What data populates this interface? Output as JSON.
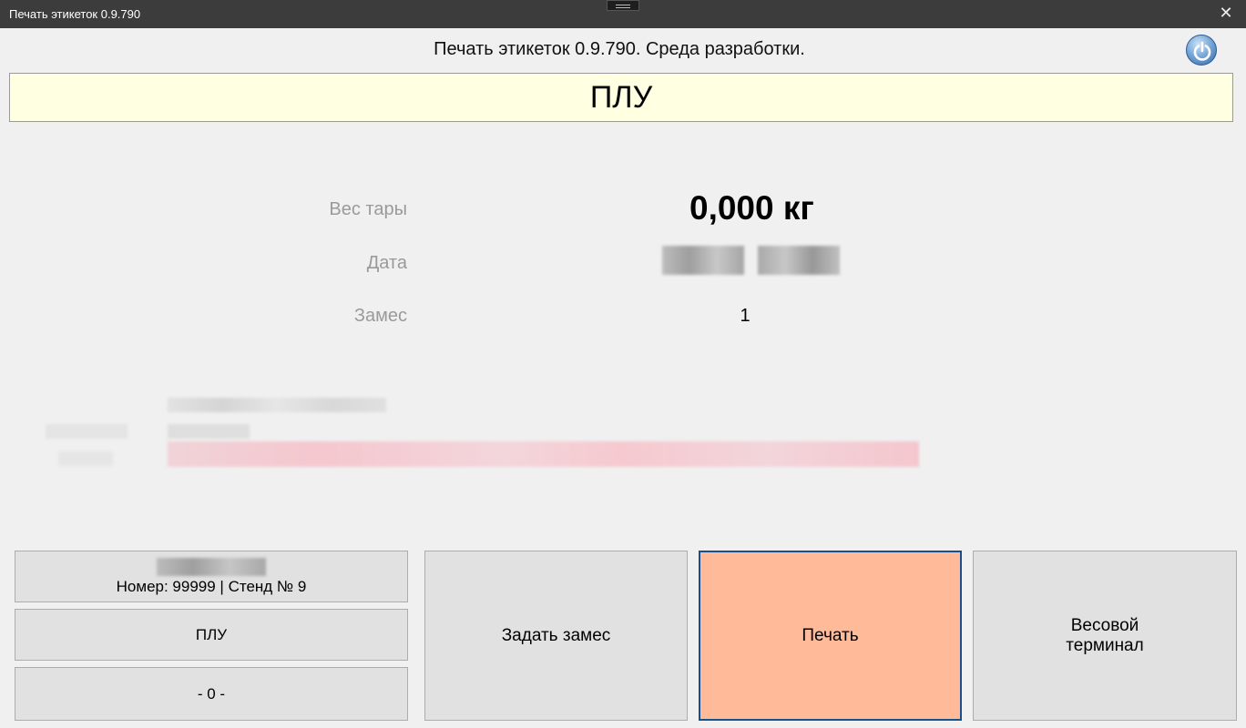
{
  "window": {
    "title": "Печать этикеток 0.9.790",
    "close_glyph": "✕"
  },
  "header": {
    "text": "Печать этикеток 0.9.790. Среда разработки.",
    "power_icon": "power-icon"
  },
  "banner": {
    "text": "ПЛУ"
  },
  "info": {
    "tare_label": "Вес тары",
    "tare_value": "0,000 кг",
    "date_label": "Дата",
    "batch_label": "Замес",
    "batch_value": "1"
  },
  "buttons": {
    "user_line": "Номер: 99999 | Стенд № 9",
    "plu": "ПЛУ",
    "counter": "- 0 -",
    "set_batch": "Задать замес",
    "print": "Печать",
    "scale_terminal_line1": "Весовой",
    "scale_terminal_line2": "терминал"
  },
  "colors": {
    "banner_bg": "#ffffe1",
    "print_bg": "#ffbb99",
    "print_border": "#1b4f8a",
    "label_gray": "#9a9a9a",
    "blurred_pink": "#f5c7cf"
  }
}
